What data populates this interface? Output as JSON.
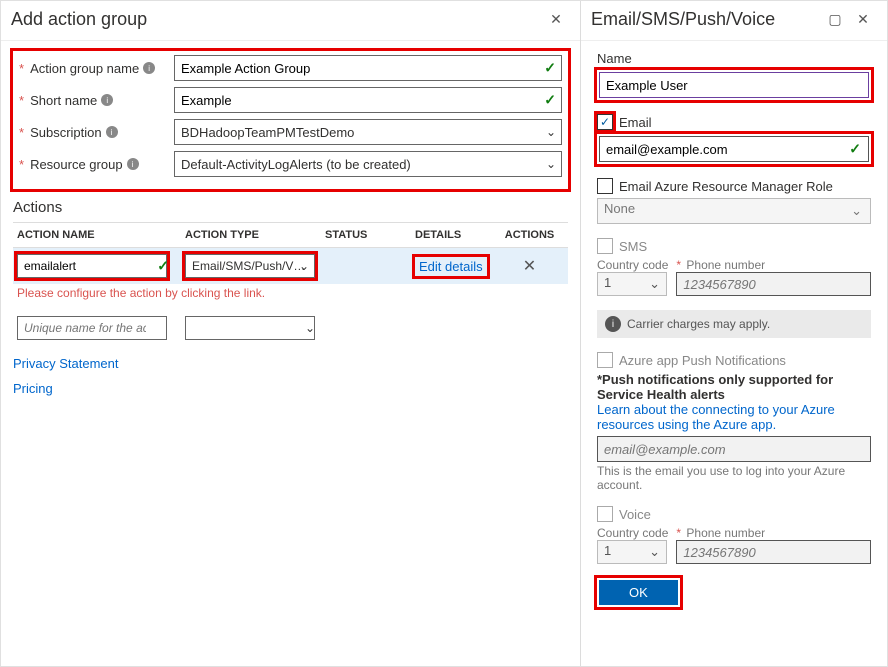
{
  "left": {
    "title": "Add action group",
    "fields": {
      "action_group_name": {
        "label": "Action group name",
        "value": "Example Action Group"
      },
      "short_name": {
        "label": "Short name",
        "value": "Example"
      },
      "subscription": {
        "label": "Subscription",
        "value": "BDHadoopTeamPMTestDemo"
      },
      "resource_group": {
        "label": "Resource group",
        "value": "Default-ActivityLogAlerts (to be created)"
      }
    },
    "actions_title": "Actions",
    "columns": {
      "name": "ACTION NAME",
      "type": "ACTION TYPE",
      "status": "STATUS",
      "details": "DETAILS",
      "actions": "ACTIONS"
    },
    "row1": {
      "name": "emailalert",
      "type": "Email/SMS/Push/V…",
      "details": "Edit details"
    },
    "row_error": "Please configure the action by clicking the link.",
    "row2_placeholder": "Unique name for the act…",
    "links": {
      "privacy": "Privacy Statement",
      "pricing": "Pricing"
    }
  },
  "right": {
    "title": "Email/SMS/Push/Voice",
    "name": {
      "label": "Name",
      "value": "Example User"
    },
    "email": {
      "label": "Email",
      "value": "email@example.com",
      "checked": true
    },
    "arm_role": {
      "label": "Email Azure Resource Manager Role",
      "value": "None"
    },
    "sms": {
      "label": "SMS",
      "country_label": "Country code",
      "country": "1",
      "phone_label": "Phone number",
      "phone_placeholder": "1234567890"
    },
    "carrier_note": "Carrier charges may apply.",
    "push": {
      "label": "Azure app Push Notifications",
      "bold": "*Push notifications only supported for Service Health alerts",
      "link": "Learn about the connecting to your Azure resources using the Azure app.",
      "placeholder": "email@example.com",
      "hint": "This is the email you use to log into your Azure account."
    },
    "voice": {
      "label": "Voice",
      "country_label": "Country code",
      "country": "1",
      "phone_label": "Phone number",
      "phone_placeholder": "1234567890"
    },
    "ok": "OK"
  }
}
